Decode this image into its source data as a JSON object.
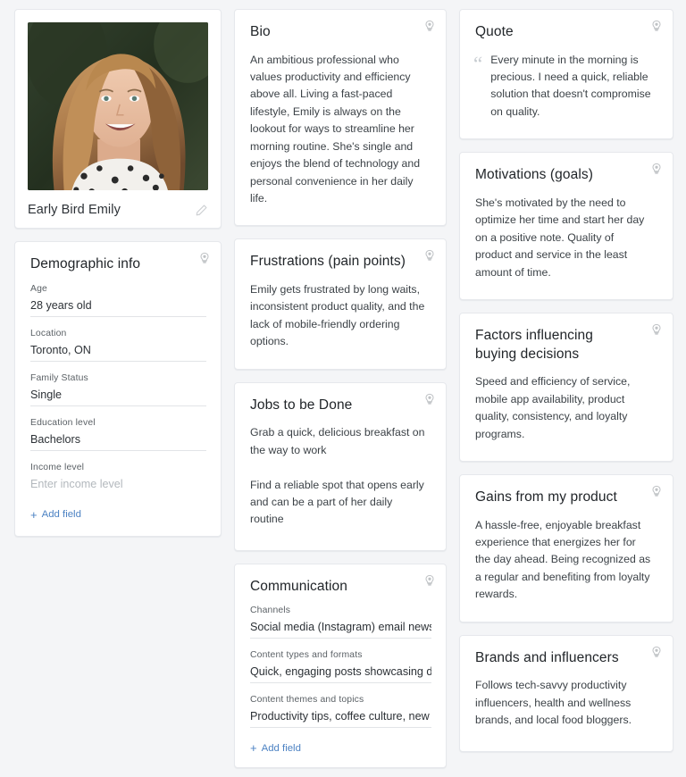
{
  "profile": {
    "name": "Early Bird Emily",
    "edit_icon": "pencil-icon",
    "photo_alt": "portrait-photo"
  },
  "demographic": {
    "title": "Demographic info",
    "fields": [
      {
        "label": "Age",
        "value": "28 years old",
        "placeholder": ""
      },
      {
        "label": "Location",
        "value": "Toronto, ON",
        "placeholder": ""
      },
      {
        "label": "Family Status",
        "value": "Single",
        "placeholder": ""
      },
      {
        "label": "Education level",
        "value": "Bachelors",
        "placeholder": ""
      },
      {
        "label": "Income level",
        "value": "",
        "placeholder": "Enter income level"
      }
    ],
    "add_field_label": "Add field",
    "add_field_plus": "+"
  },
  "bio": {
    "title": "Bio",
    "text": "An ambitious professional who values productivity and efficiency above all. Living a fast-paced lifestyle, Emily is always on the lookout for ways to streamline her morning routine. She's single and enjoys the blend of technology and personal convenience in her daily life."
  },
  "frustrations": {
    "title": "Frustrations (pain points)",
    "text": "Emily gets frustrated by long waits, inconsistent product quality, and the lack of mobile-friendly ordering options."
  },
  "jobs": {
    "title": "Jobs to be Done",
    "text": "Grab a quick, delicious breakfast on the way to work\n\nFind a reliable spot that opens early and can be a part of her daily routine"
  },
  "communication": {
    "title": "Communication",
    "fields": [
      {
        "label": "Channels",
        "value": "Social media (Instagram) email newsletters"
      },
      {
        "label": "Content types and formats",
        "value": "Quick, engaging posts showcasing daily routines"
      },
      {
        "label": "Content themes and topics",
        "value": "Productivity tips, coffee culture, new products"
      }
    ],
    "add_field_label": "Add field",
    "add_field_plus": "+"
  },
  "quote": {
    "title": "Quote",
    "mark": "“",
    "text": "Every minute in the morning is precious. I need a quick, reliable solution that doesn't compromise on quality."
  },
  "motivations": {
    "title": "Motivations (goals)",
    "text": "She's motivated by the need to optimize her time and start her day on a positive note. Quality of product and service in the least amount of time."
  },
  "factors": {
    "title": "Factors influencing buying decisions",
    "text": "Speed and efficiency of service, mobile app availability, product quality, consistency, and loyalty programs."
  },
  "gains": {
    "title": "Gains from my product",
    "text": "A hassle-free, enjoyable breakfast experience that energizes her for the day ahead. Being recognized as a regular and benefiting from loyalty rewards."
  },
  "brands": {
    "title": "Brands and influencers",
    "text": "Follows tech-savvy productivity influencers, health and wellness brands, and local food bloggers."
  },
  "colors": {
    "page_bg": "#f4f5f7",
    "card_bg": "#ffffff",
    "border": "#e6e8ec",
    "link": "#4c82c3",
    "title": "#212529",
    "body": "#3c4247",
    "label": "#5b6166",
    "placeholder": "#b3b8bd"
  }
}
